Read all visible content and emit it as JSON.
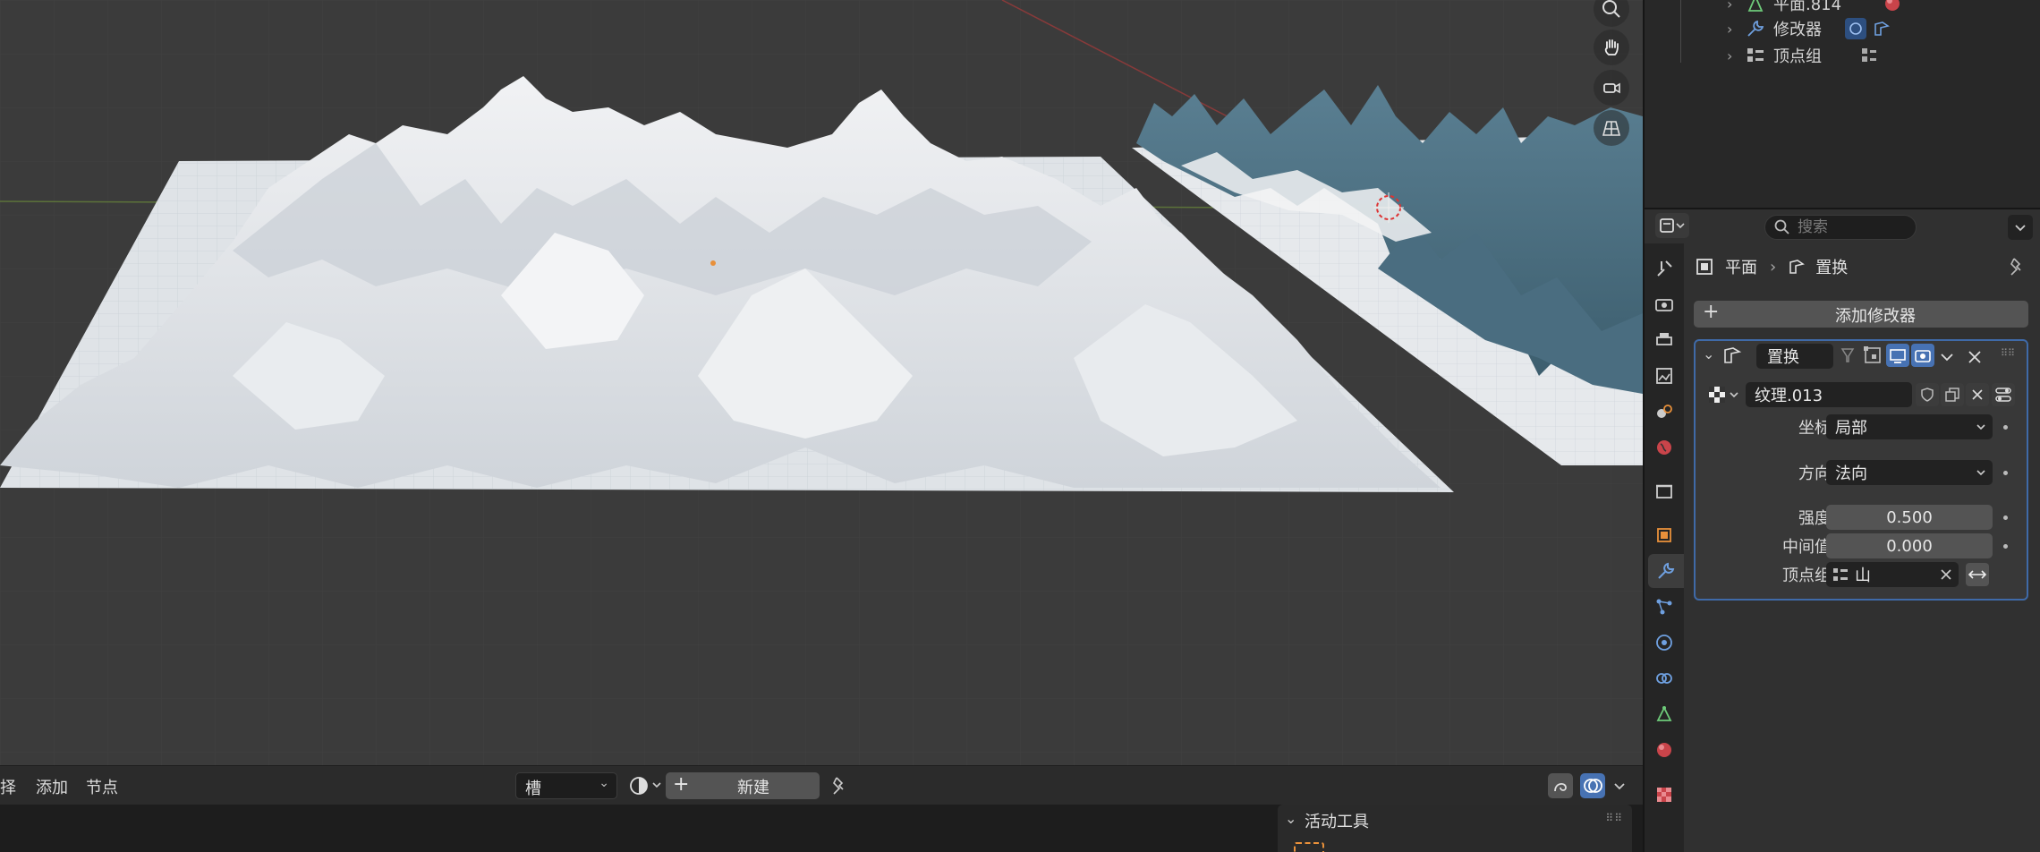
{
  "outliner": {
    "rows": [
      {
        "label": "平面.814",
        "icon": "mesh-data-icon"
      },
      {
        "label": "修改器",
        "icon": "wrench-icon"
      },
      {
        "label": "顶点组",
        "icon": "vertex-group-icon"
      }
    ]
  },
  "properties": {
    "search_placeholder": "搜索",
    "breadcrumb": {
      "object": "平面",
      "modifier": "置换"
    },
    "add_modifier_label": "添加修改器",
    "modifier": {
      "name": "置换",
      "texture": "纹理.013",
      "coordinates_label": "坐标",
      "coordinates_value": "局部",
      "direction_label": "方向",
      "direction_value": "法向",
      "strength_label": "强度",
      "strength_value": "0.500",
      "midlevel_label": "中间值",
      "midlevel_value": "0.000",
      "vertex_group_label": "顶点组",
      "vertex_group_value": "山"
    }
  },
  "node_header": {
    "menus": [
      "择",
      "添加",
      "节点"
    ],
    "slot_label": "槽",
    "new_label": "新建"
  },
  "sidebar_panel": {
    "title": "活动工具"
  },
  "colors": {
    "accent": "#4772b3",
    "panel_border": "#3f6aa8",
    "terrain_white": "#d9dde2",
    "terrain_blue": "#4d7285"
  }
}
